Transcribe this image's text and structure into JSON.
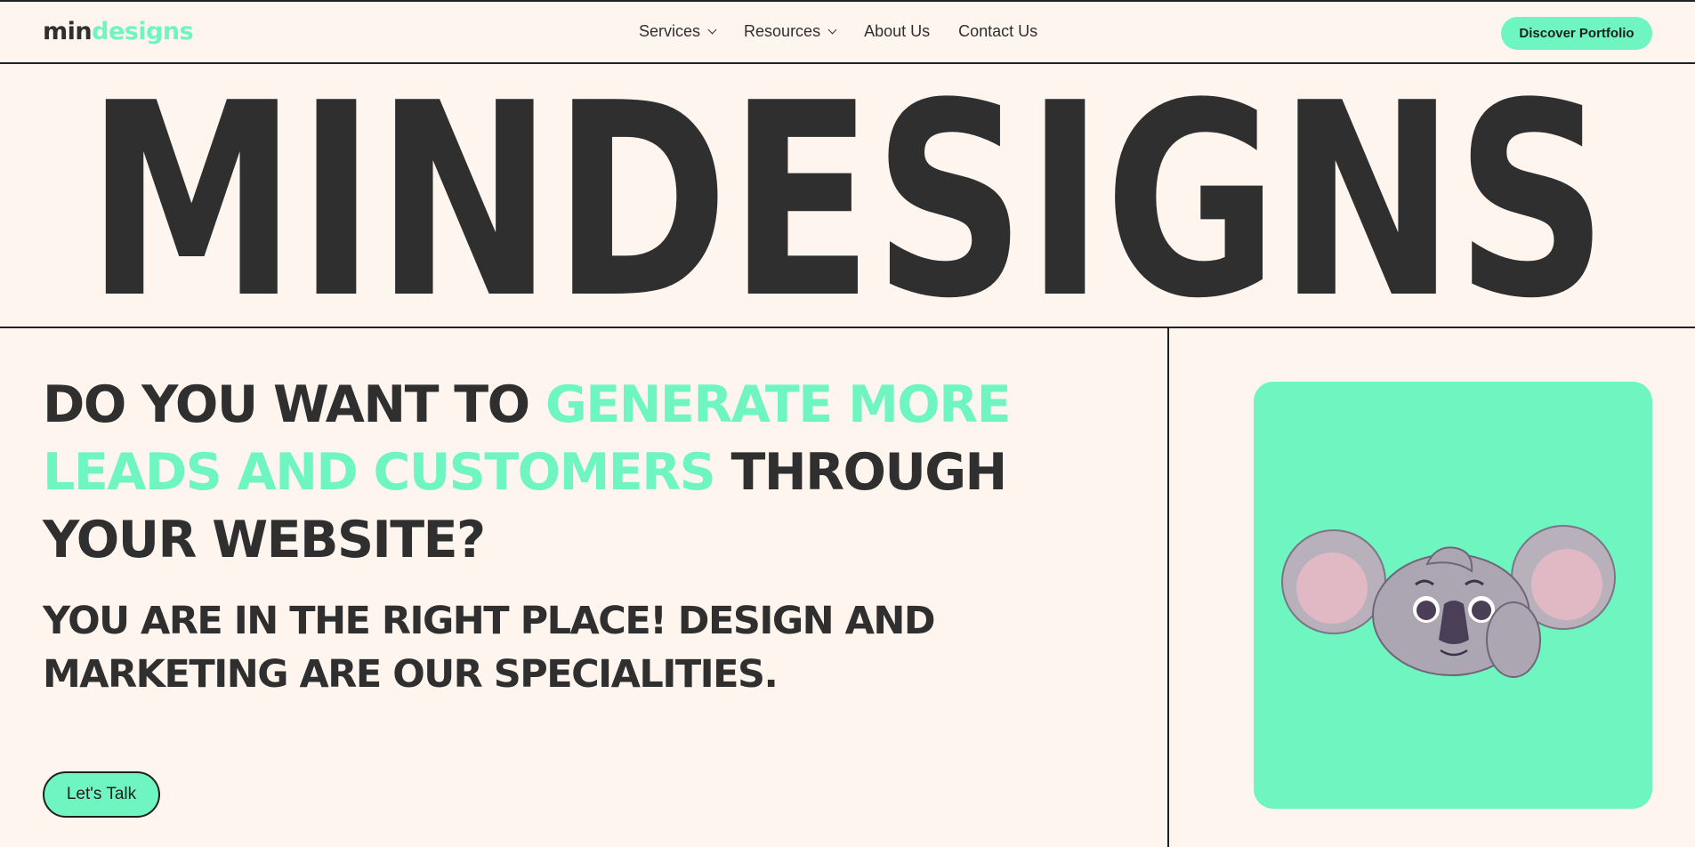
{
  "nav": {
    "logo_part1": "min",
    "logo_part2": "designs",
    "items": [
      {
        "label": "Services",
        "has_dropdown": true
      },
      {
        "label": "Resources",
        "has_dropdown": true
      },
      {
        "label": "About Us",
        "has_dropdown": false
      },
      {
        "label": "Contact Us",
        "has_dropdown": false
      }
    ],
    "cta_label": "Discover Portfolio"
  },
  "hero": {
    "wordmark": "MINDESIGNS"
  },
  "main": {
    "headline_part1": "Do you want to ",
    "headline_highlight": "generate more leads and customers",
    "headline_part2": " through your website?",
    "subline": "You are in the right place! Design and marketing are our specialities.",
    "talk_label": "Let's Talk",
    "illustration_icon": "koala-illustration"
  },
  "colors": {
    "accent": "#6ff5c0",
    "text": "#2f2f2f",
    "background": "#fff5ef"
  }
}
